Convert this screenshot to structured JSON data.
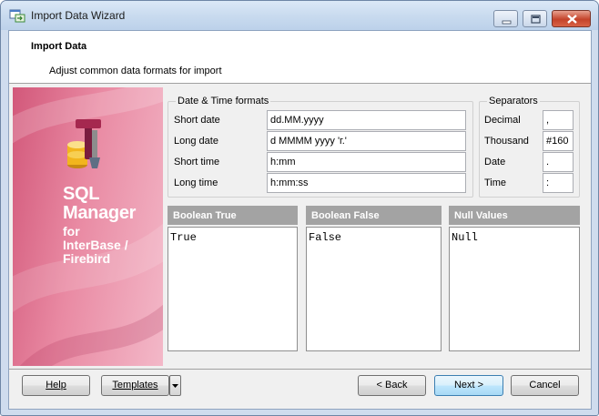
{
  "window": {
    "title": "Import Data Wizard",
    "icons": [
      "app-icon",
      "minimize-icon",
      "maximize-icon",
      "close-icon"
    ]
  },
  "header": {
    "title": "Import Data",
    "subtitle": "Adjust common data formats for import"
  },
  "banner": {
    "product_line1": "SQL",
    "product_line2": "Manager",
    "product_line3": "for",
    "product_line4": "InterBase /",
    "product_line5": "Firebird",
    "icon": "database-tools-icon",
    "color": "#d8607f"
  },
  "datetime": {
    "legend": "Date & Time formats",
    "short_date_label": "Short date",
    "short_date_value": "dd.MM.yyyy",
    "long_date_label": "Long date",
    "long_date_value": "d MMMM yyyy 'г.'",
    "short_time_label": "Short time",
    "short_time_value": "h:mm",
    "long_time_label": "Long time",
    "long_time_value": "h:mm:ss"
  },
  "separators": {
    "legend": "Separators",
    "decimal_label": "Decimal",
    "decimal_value": ",",
    "thousand_label": "Thousand",
    "thousand_value": "#160",
    "date_label": "Date",
    "date_value": ".",
    "time_label": "Time",
    "time_value": ":"
  },
  "panels": {
    "boolean_true_header": "Boolean True",
    "boolean_true_value": "True",
    "boolean_false_header": "Boolean False",
    "boolean_false_value": "False",
    "null_values_header": "Null Values",
    "null_values_value": "Null"
  },
  "footer": {
    "help_label": "Help",
    "templates_label": "Templates",
    "back_label": "< Back",
    "next_label": "Next >",
    "cancel_label": "Cancel"
  }
}
